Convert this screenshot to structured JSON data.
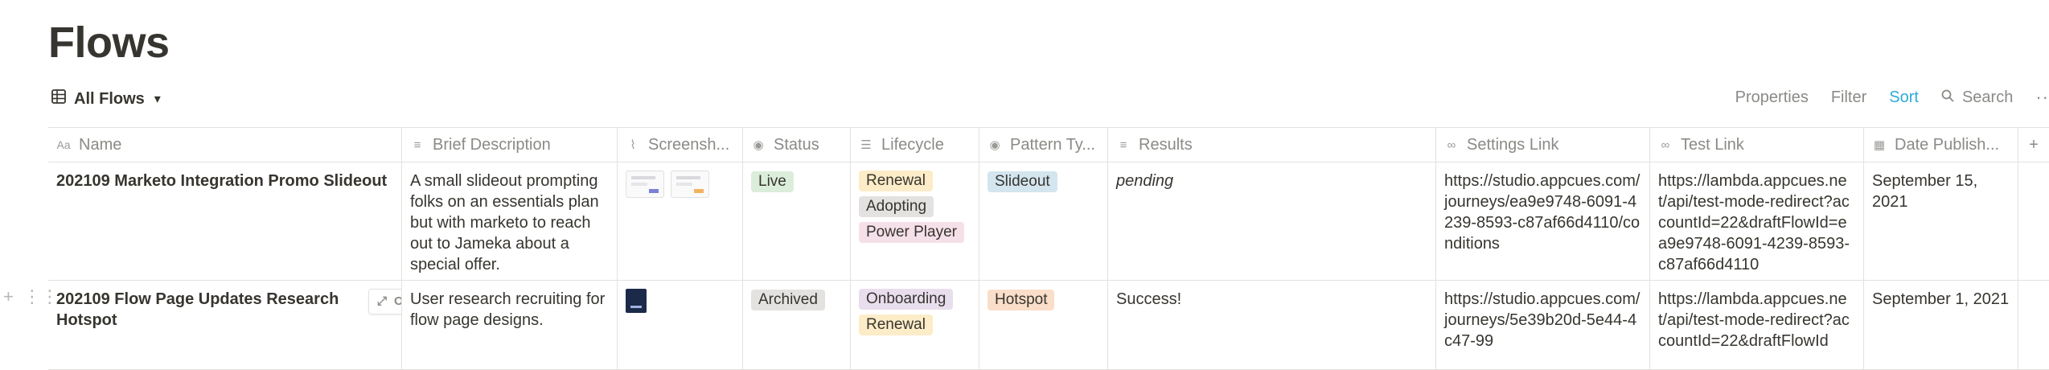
{
  "page": {
    "title": "Flows"
  },
  "view": {
    "icon": "table-icon",
    "label": "All Flows"
  },
  "toolbar": {
    "properties": "Properties",
    "filter": "Filter",
    "sort": "Sort",
    "search": "Search"
  },
  "columns": [
    {
      "label": "Name",
      "icon": "text-aa-icon"
    },
    {
      "label": "Brief Description",
      "icon": "text-lines-icon"
    },
    {
      "label": "Screensh...",
      "icon": "paperclip-icon"
    },
    {
      "label": "Status",
      "icon": "select-icon"
    },
    {
      "label": "Lifecycle",
      "icon": "multi-select-icon"
    },
    {
      "label": "Pattern Ty...",
      "icon": "select-icon"
    },
    {
      "label": "Results",
      "icon": "text-lines-icon"
    },
    {
      "label": "Settings Link",
      "icon": "link-icon"
    },
    {
      "label": "Test Link",
      "icon": "link-icon"
    },
    {
      "label": "Date Publish...",
      "icon": "calendar-icon"
    }
  ],
  "rows": [
    {
      "name": "202109 Marketo Integration Promo Slideout",
      "description": "A small slideout prompting folks on an essentials plan but with marketo to reach out to Jameka about a special offer.",
      "status": "Live",
      "lifecycle": [
        "Renewal",
        "Adopting",
        "Power Player"
      ],
      "pattern": "Slideout",
      "results": "pending",
      "settings_link": "https://studio.appcues.com/journeys/ea9e9748-6091-4239-8593-c87af66d4110/conditions",
      "test_link": "https://lambda.appcues.net/api/test-mode-redirect?accountId=22&draftFlowId=ea9e9748-6091-4239-8593-c87af66d4110",
      "date": "September 15, 2021"
    },
    {
      "name": "202109 Flow Page Updates Research Hotspot",
      "description": "User research recruiting for flow page designs.",
      "status": "Archived",
      "lifecycle": [
        "Onboarding",
        "Renewal"
      ],
      "pattern": "Hotspot",
      "results": "Success!",
      "settings_link": "https://studio.appcues.com/journeys/5e39b20d-5e44-4c47-99",
      "test_link": "https://lambda.appcues.net/api/test-mode-redirect?accountId=22&draftFlowId",
      "date": "September 1, 2021",
      "open_label": "OPEN"
    }
  ],
  "colors": {
    "live": "#dbeddb",
    "archived": "#e3e2e0",
    "renewal": "#fdecc8",
    "adopting": "#e3e2e0",
    "power_player": "#f5e0e9",
    "onboarding": "#e8deee",
    "slideout": "#d3e5ef",
    "hotspot": "#fadec9",
    "sort_accent": "#2eaadc"
  }
}
